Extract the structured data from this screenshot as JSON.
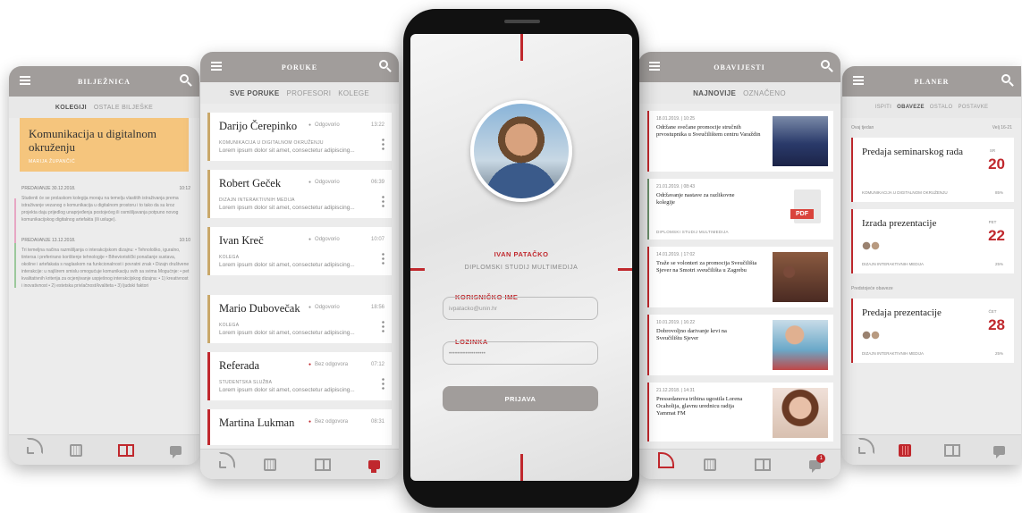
{
  "biljeznica": {
    "title": "BILJEŽNICA",
    "tabs": [
      "KOLEGIJI",
      "OSTALE BILJEŠKE"
    ],
    "card_title": "Komunikacija u digitalnom okruženju",
    "card_author": "MARIJA ŽUPANČIĆ",
    "sections": [
      {
        "label": "PREDAVANJE 30.12.2018.",
        "time": "10:12",
        "body": "Studenti će se prolaskom kolegija moraju na temelju vlastitih istraživanja prema istraživanje vezanog o komunikacija u digitalnom prostoru i to tako da su kroz projekta daju prijedlog unaprjeđenja postojećeg ili osmišljavanja potpuno novog komunikacijskog digitalnog artefakta (ili usluge)."
      },
      {
        "label": "PREDAVANJE 13.12.2018.",
        "time": "10:10",
        "body": "Tri temeljna načina razmišljanja o interakcijskom dizajnu: • Tehnološko, iguralno, tintersa i preferirano korištenje tehnologije • Bihevioristički ponašanje sustava, okoline i artefakata s naglaskom na funkcionalnost i povratni znak • Dizajn društvene interakcije: u najširem smislu omogućuje komunikaciju svih sa svima Mogućnje: • pet kvalitativnih kriterija za ocjenjivanje uspješnog interakcijskog dizajna: • 1) kreativnost i inovativnost • 2) estetska privlačnost/kvaliteta • 3) ljudski faktori"
      }
    ]
  },
  "poruke": {
    "title": "PORUKE",
    "tabs": [
      "SVE PORUKE",
      "PROFESORI",
      "KOLEGE"
    ],
    "messages": [
      {
        "name": "Darijo Čerepinko",
        "status": "Odgovorio",
        "time": "13:22",
        "category": "KOMUNIKACIJA U DIGITALNOM OKRUŽENJU",
        "preview": "Lorem ipsum dolor sit amet, consectetur adipiscing..."
      },
      {
        "name": "Robert Geček",
        "status": "Odgovorio",
        "time": "06:39",
        "category": "DIZAJN INTERAKTIVNIH MEDIJA",
        "preview": "Lorem ipsum dolor sit amet, consectetur adipiscing..."
      },
      {
        "name": "Ivan Kreč",
        "status": "Odgovorio",
        "time": "10:07",
        "category": "KOLEGA",
        "preview": "Lorem ipsum dolor sit amet, consectetur adipiscing..."
      },
      {
        "name": "Mario Dubovečak",
        "status": "Odgovorio",
        "time": "18:56",
        "category": "KOLEGA",
        "preview": "Lorem ipsum dolor sit amet, consectetur adipiscing..."
      },
      {
        "name": "Referada",
        "status": "Bez odgovora",
        "time": "07:12",
        "category": "STUDENTSKA SLUŽBA",
        "preview": "Lorem ipsum dolor sit amet, consectetur adipiscing..."
      },
      {
        "name": "Martina Lukman",
        "status": "Bez odgovora",
        "time": "08:31",
        "category": "",
        "preview": ""
      }
    ]
  },
  "login": {
    "name": "IVAN PATAČKO",
    "study": "DIPLOMSKI STUDIJ MULTIMEDIJA",
    "username_label": "KORISNIČKO IME",
    "username_value": "ivpatacko@unin.hr",
    "password_label": "LOZINKA",
    "password_value": "••••••••••••••••••",
    "button": "PRIJAVA"
  },
  "obavijesti": {
    "title": "OBAVIJESTI",
    "tabs": [
      "NAJNOVIJE",
      "OZNAČENO"
    ],
    "items": [
      {
        "date": "18.01.2019. | 10:25",
        "text": "Održane svečane promocije stručnih prvostupnika u Sveučilištem centru Varaždin"
      },
      {
        "date": "21.01.2019. | 08:43",
        "text": "Održavanje nastave za razlikovne kolegije",
        "footer": "DIPLOMSKI STUDIJ MULTIMEDIJA",
        "pdf": "PDF"
      },
      {
        "date": "14.01.2019. | 17:02",
        "text": "Traže se volonteri za promocija Sveučilišta Sjever na Smotri sveučilišta u Zagrebu"
      },
      {
        "date": "10.01.2019. | 16:22",
        "text": "Dobrovoljno darivanje krvi na Sveučilištu Sjever"
      },
      {
        "date": "21.12.2018. | 14:31",
        "text": "Pressedanova tribina ugostila Lorena Ocaholija, glavnu urednicu radija Yammat FM"
      }
    ],
    "badge": "1"
  },
  "planer": {
    "title": "PLANER",
    "tabs": [
      "ISPITI",
      "OBAVEZE",
      "OSTALO",
      "POSTAVKE"
    ],
    "section1": "Ovaj tjedan",
    "section1_right": "Velj 16-21",
    "section2": "Predstojeće obaveze",
    "tasks": [
      {
        "title": "Predaja seminarskog rada",
        "dow": "SR",
        "day": "20",
        "sub": "KOMUNIKACIJA U DIGITALNOM OKRUŽENJU",
        "pct": "85%"
      },
      {
        "title": "Izrada prezentacije",
        "dow": "PET",
        "day": "22",
        "sub": "DIZAJN INTERAKTIVNIH MEDIJA",
        "pct": "25%"
      },
      {
        "title": "Predaja prezentacije",
        "dow": "ČET",
        "day": "28",
        "sub": "DIZAJN INTERAKTIVNIH MEDIJA",
        "pct": "25%"
      }
    ]
  },
  "colors": {
    "accent": "#c0282d",
    "header": "#a19d9b",
    "note": "#f5c57d"
  }
}
